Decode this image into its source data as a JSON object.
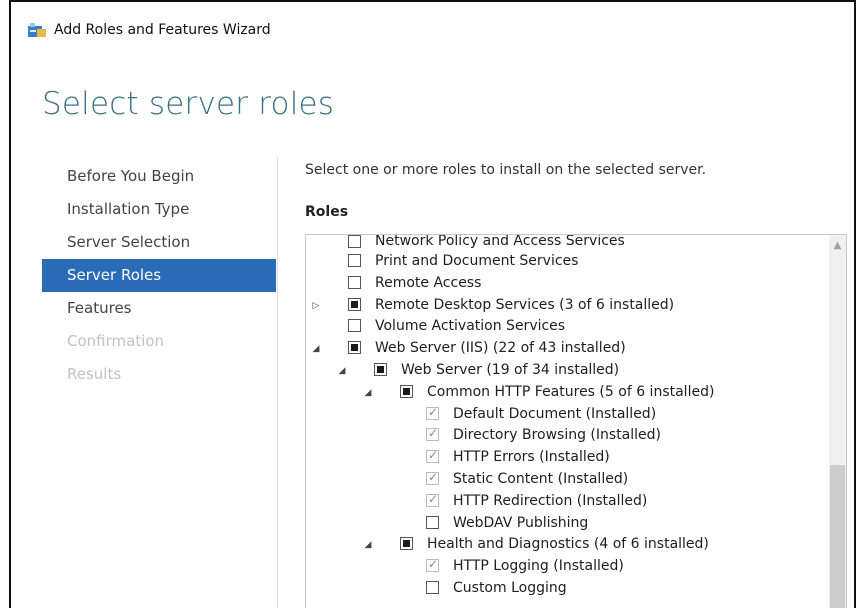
{
  "window": {
    "title": "Add Roles and Features Wizard"
  },
  "page_title": "Select server roles",
  "nav": {
    "items": [
      {
        "label": "Before You Begin",
        "state": "normal"
      },
      {
        "label": "Installation Type",
        "state": "normal"
      },
      {
        "label": "Server Selection",
        "state": "normal"
      },
      {
        "label": "Server Roles",
        "state": "active"
      },
      {
        "label": "Features",
        "state": "normal"
      },
      {
        "label": "Confirmation",
        "state": "disabled"
      },
      {
        "label": "Results",
        "state": "disabled"
      }
    ]
  },
  "main": {
    "instructions": "Select one or more roles to install on the selected server.",
    "roles_label": "Roles",
    "roles": [
      {
        "label": "Network Policy and Access Services",
        "level": 0,
        "check": "unchecked",
        "expander": "none"
      },
      {
        "label": "Print and Document Services",
        "level": 0,
        "check": "unchecked",
        "expander": "none"
      },
      {
        "label": "Remote Access",
        "level": 0,
        "check": "unchecked",
        "expander": "none"
      },
      {
        "label": "Remote Desktop Services (3 of 6 installed)",
        "level": 0,
        "check": "partial",
        "expander": "collapsed"
      },
      {
        "label": "Volume Activation Services",
        "level": 0,
        "check": "unchecked",
        "expander": "none"
      },
      {
        "label": "Web Server (IIS) (22 of 43 installed)",
        "level": 0,
        "check": "partial",
        "expander": "expanded"
      },
      {
        "label": "Web Server (19 of 34 installed)",
        "level": 1,
        "check": "partial",
        "expander": "expanded"
      },
      {
        "label": "Common HTTP Features (5 of 6 installed)",
        "level": 2,
        "check": "partial",
        "expander": "expanded"
      },
      {
        "label": "Default Document (Installed)",
        "level": 3,
        "check": "installed",
        "expander": "none"
      },
      {
        "label": "Directory Browsing (Installed)",
        "level": 3,
        "check": "installed",
        "expander": "none"
      },
      {
        "label": "HTTP Errors (Installed)",
        "level": 3,
        "check": "installed",
        "expander": "none"
      },
      {
        "label": "Static Content (Installed)",
        "level": 3,
        "check": "installed",
        "expander": "none"
      },
      {
        "label": "HTTP Redirection (Installed)",
        "level": 3,
        "check": "installed",
        "expander": "none"
      },
      {
        "label": "WebDAV Publishing",
        "level": 3,
        "check": "unchecked",
        "expander": "none"
      },
      {
        "label": "Health and Diagnostics (4 of 6 installed)",
        "level": 2,
        "check": "partial",
        "expander": "expanded"
      },
      {
        "label": "HTTP Logging (Installed)",
        "level": 3,
        "check": "installed",
        "expander": "none"
      },
      {
        "label": "Custom Logging",
        "level": 3,
        "check": "unchecked",
        "expander": "none"
      }
    ]
  },
  "icons": {
    "title": "server-manager-icon",
    "expanded": "triangle-expanded-icon",
    "collapsed": "triangle-collapsed-icon",
    "scroll_up": "scroll-up-arrow-icon"
  },
  "colors": {
    "accent": "#2a6cb8",
    "page_title": "#3a6f84",
    "disabled_text": "#c2c2c2"
  }
}
